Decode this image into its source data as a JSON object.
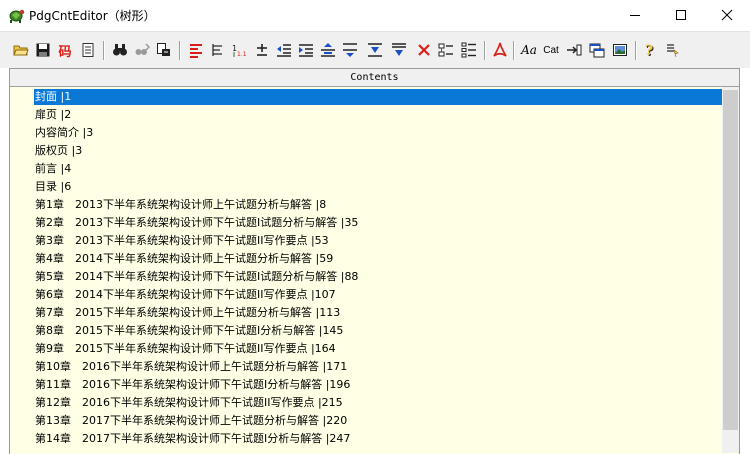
{
  "window": {
    "title": "PdgCntEditor（树形）"
  },
  "toolbar": {
    "buttons": [
      {
        "name": "open-icon"
      },
      {
        "name": "save-icon"
      },
      {
        "name": "code-icon",
        "label": "码"
      },
      {
        "name": "notepad-icon"
      },
      {
        "name": "binoculars-icon"
      },
      {
        "name": "find-next-icon"
      },
      {
        "name": "replace-icon"
      },
      {
        "name": "align-left-icon"
      },
      {
        "name": "tree-indent-icon"
      },
      {
        "name": "number-icon"
      },
      {
        "name": "plus-minus-icon"
      },
      {
        "name": "outdent-icon"
      },
      {
        "name": "indent-icon"
      },
      {
        "name": "move-up-icon"
      },
      {
        "name": "move-down-icon"
      },
      {
        "name": "insert-above-icon"
      },
      {
        "name": "insert-below-icon"
      },
      {
        "name": "delete-icon"
      },
      {
        "name": "collapse-icon"
      },
      {
        "name": "expand-icon"
      },
      {
        "name": "pdf-icon"
      },
      {
        "name": "font-icon",
        "label": "Aa"
      },
      {
        "name": "catalog-icon",
        "label": "Cat"
      },
      {
        "name": "goto-icon"
      },
      {
        "name": "window-icon"
      },
      {
        "name": "image-icon"
      },
      {
        "name": "help-icon"
      },
      {
        "name": "about-icon"
      }
    ]
  },
  "tree": {
    "header": "Contents",
    "items": [
      "封面 |1",
      "扉页 |2",
      "内容简介 |3",
      "版权页 |3",
      "前言 |4",
      "目录 |6",
      "第1章　2013下半年系统架构设计师上午试题分析与解答 |8",
      "第2章　2013下半年系统架构设计师下午试题I试题分析与解答 |35",
      "第3章　2013下半年系统架构设计师下午试题II写作要点 |53",
      "第4章　2014下半年系统架构设计师上午试题分析与解答 |59",
      "第5章　2014下半年系统架构设计师下午试题I试题分析与解答 |88",
      "第6章　2014下半年系统架构设计师下午试题II写作要点 |107",
      "第7章　2015下半年系统架构设计师上午试题分析与解答 |113",
      "第8章　2015下半年系统架构设计师下午试题I分析与解答 |145",
      "第9章　2015下半年系统架构设计师下午试题II写作要点 |164",
      "第10章　2016下半年系统架构设计师上午试题分析与解答 |171",
      "第11章　2016下半年系统架构设计师下午试题I分析与解答 |196",
      "第12章　2016下半年系统架构设计师下午试题II写作要点 |215",
      "第13章　2017下半年系统架构设计师上午试题分析与解答 |220",
      "第14章　2017下半年系统架构设计师下午试题I分析与解答 |247"
    ],
    "selected_index": 0
  },
  "colors": {
    "selection": "#0a78d7",
    "tree_background": "#ffffe6",
    "toolbar_background": "#f0f0f0"
  }
}
